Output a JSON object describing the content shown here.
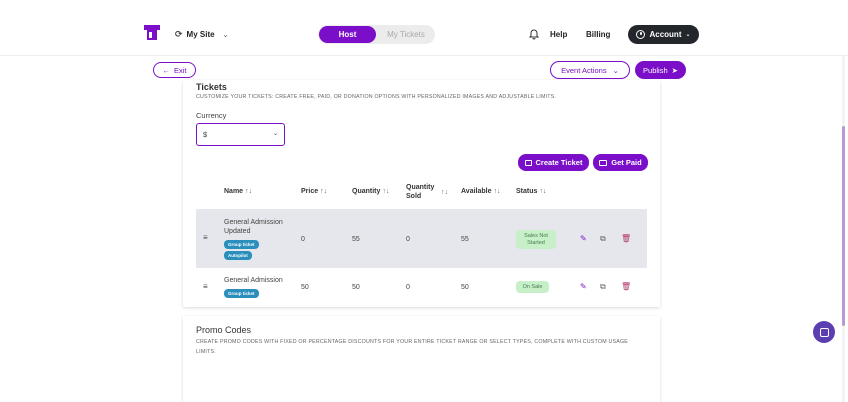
{
  "topbar": {
    "site_label": "My Site",
    "tabs": {
      "host": "Host",
      "my_tickets": "My Tickets"
    },
    "help": "Help",
    "billing": "Billing",
    "account": "Account"
  },
  "subbar": {
    "exit": "Exit",
    "event_actions": "Event Actions",
    "publish": "Publish"
  },
  "tickets": {
    "title": "Tickets",
    "subtitle": "CUSTOMIZE YOUR TICKETS: CREATE FREE, PAID, OR DONATION OPTIONS WITH PERSONALIZED IMAGES AND ADJUSTABLE LIMITS.",
    "currency_label": "Currency",
    "currency_value": "$",
    "create_ticket": "Create Ticket",
    "get_paid": "Get Paid",
    "columns": {
      "name": "Name",
      "price": "Price",
      "quantity": "Quantity",
      "quantity_sold_1": "Quantity",
      "quantity_sold_2": "Sold",
      "available": "Available",
      "status": "Status"
    },
    "rows": [
      {
        "name_1": "General Admission",
        "name_2": "Updated",
        "badges": [
          "Group ticket",
          "Autopilot"
        ],
        "price": "0",
        "quantity": "55",
        "sold": "0",
        "available": "55",
        "status_1": "Sales Not",
        "status_2": "Started"
      },
      {
        "name_1": "General Admission",
        "badges": [
          "Group ticket"
        ],
        "price": "50",
        "quantity": "50",
        "sold": "0",
        "available": "50",
        "status_1": "On Sale"
      }
    ]
  },
  "promo": {
    "title": "Promo Codes",
    "subtitle": "CREATE PROMO CODES WITH FIXED OR PERCENTAGE DISCOUNTS FOR YOUR ENTIRE TICKET RANGE OR SELECT TYPES, COMPLETE WITH CUSTOM USAGE LIMITS."
  },
  "colors": {
    "accent": "#7a0ec9",
    "badge": "#2a8fbd",
    "status_green": "#c7f0c9"
  }
}
